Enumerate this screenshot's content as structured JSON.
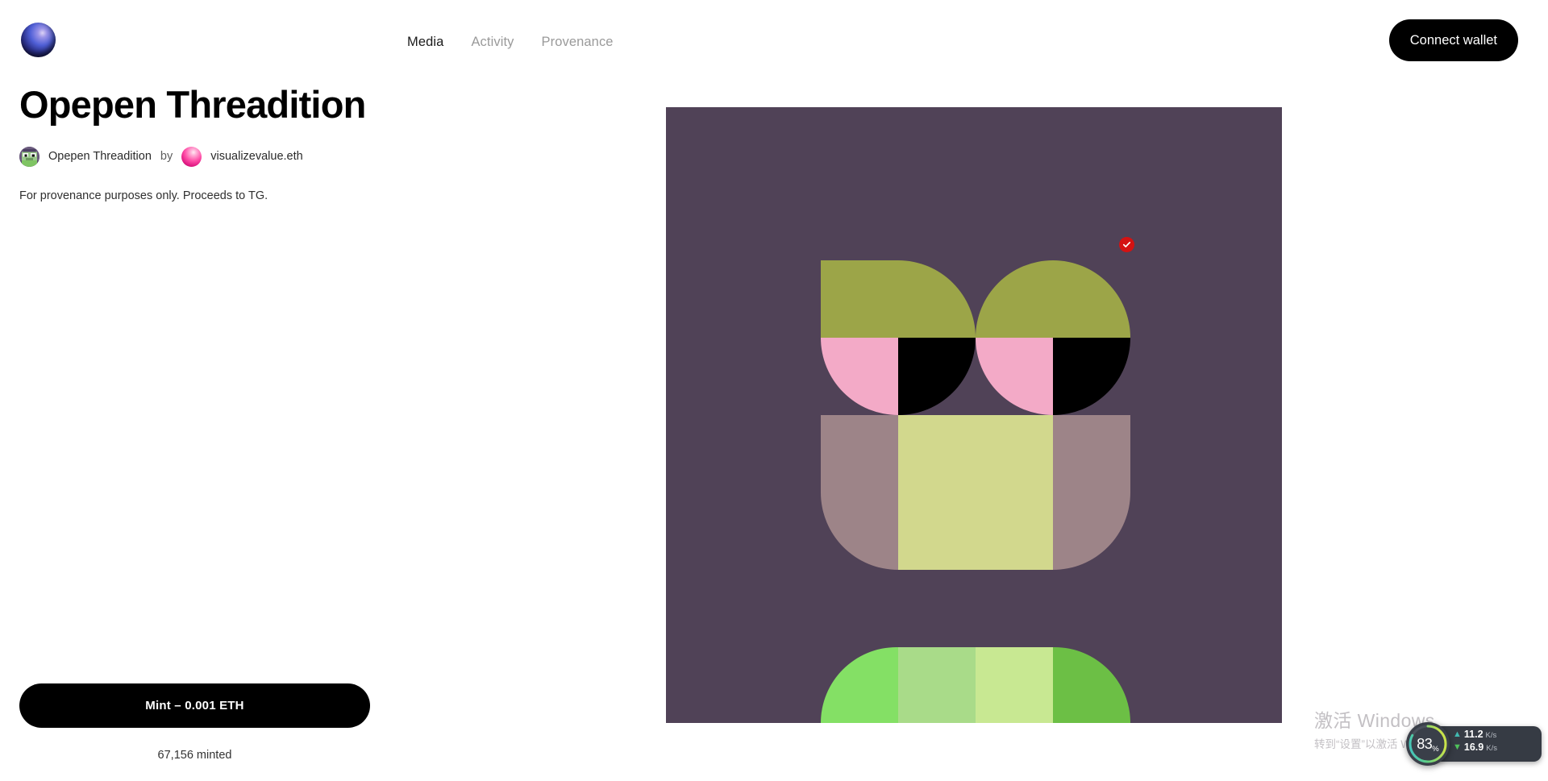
{
  "header": {
    "logo_icon": "sphere-logo-icon",
    "nav": [
      {
        "label": "Media",
        "active": true
      },
      {
        "label": "Activity",
        "active": false
      },
      {
        "label": "Provenance",
        "active": false
      }
    ],
    "connect_wallet_label": "Connect wallet"
  },
  "main": {
    "title": "Opepen Threadition",
    "collection_name": "Opepen Threadition",
    "by_label": "by",
    "artist_name": "visualizevalue.eth",
    "description": "For provenance purposes only. Proceeds to TG.",
    "mint_button_label": "Mint – 0.001 ETH",
    "minted_count": "67,156 minted"
  },
  "artwork": {
    "background_color": "#504257",
    "olive": "#9ca548",
    "pink": "#f3aac7",
    "black": "#000000",
    "mauve": "#9d8488",
    "light_green": "#d2d88d",
    "strip_1": "#84e065",
    "strip_2": "#a9db89",
    "strip_3": "#c8e892",
    "strip_4": "#6cbf45",
    "badge_color": "#d41212",
    "badge_icon": "verified-check-icon"
  },
  "windows_watermark": {
    "title": "激活 Windows",
    "subtitle": "转到“设置”以激活 Windows。"
  },
  "network_widget": {
    "cpu_percent": "83",
    "percent_symbol": "%",
    "upload_arrow": "▲",
    "upload_value": "11.2",
    "upload_unit": "K/s",
    "download_arrow": "▼",
    "download_value": "16.9",
    "download_unit": "K/s",
    "ring_color_start": "#3fc2c8",
    "ring_color_end": "#c8e24a"
  }
}
